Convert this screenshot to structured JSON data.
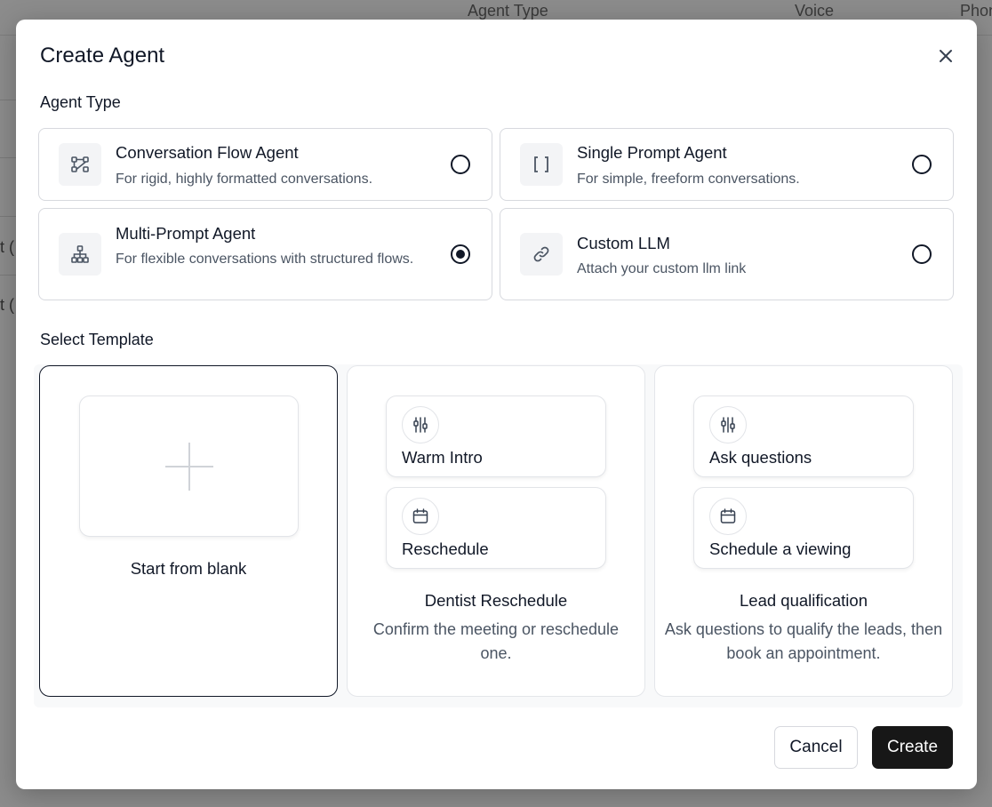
{
  "background": {
    "columns": [
      "Agent Type",
      "Voice",
      "Phon"
    ],
    "row_fragments": [
      "t (",
      "t ("
    ]
  },
  "modal": {
    "title": "Create Agent",
    "close_icon": "close-icon"
  },
  "agent_type": {
    "label": "Agent Type",
    "options": [
      {
        "title": "Conversation Flow Agent",
        "desc": "For rigid, highly formatted conversations.",
        "icon": "flow-icon",
        "selected": false
      },
      {
        "title": "Single Prompt Agent",
        "desc": "For simple, freeform conversations.",
        "icon": "brackets-icon",
        "selected": false
      },
      {
        "title": "Multi-Prompt Agent",
        "desc": "For flexible conversations with structured flows.",
        "icon": "hierarchy-icon",
        "selected": true
      },
      {
        "title": "Custom LLM",
        "desc": "Attach your custom llm link",
        "icon": "link-icon",
        "selected": false
      }
    ]
  },
  "template": {
    "label": "Select Template",
    "blank": {
      "label": "Start from blank"
    },
    "cards": [
      {
        "title": "Dentist Reschedule",
        "desc": "Confirm the meeting or reschedule one.",
        "nodes": [
          {
            "label": "Warm Intro",
            "icon": "sliders-icon"
          },
          {
            "label": "Reschedule",
            "icon": "calendar-icon"
          }
        ]
      },
      {
        "title": "Lead qualification",
        "desc": "Ask questions to qualify the leads, then book an appointment.",
        "nodes": [
          {
            "label": "Ask questions",
            "icon": "sliders-icon"
          },
          {
            "label": "Schedule a viewing",
            "icon": "calendar-icon"
          }
        ]
      }
    ]
  },
  "footer": {
    "cancel": "Cancel",
    "create": "Create"
  },
  "colors": {
    "primary_button": "#171717",
    "overlay": "#8c8c8c"
  }
}
